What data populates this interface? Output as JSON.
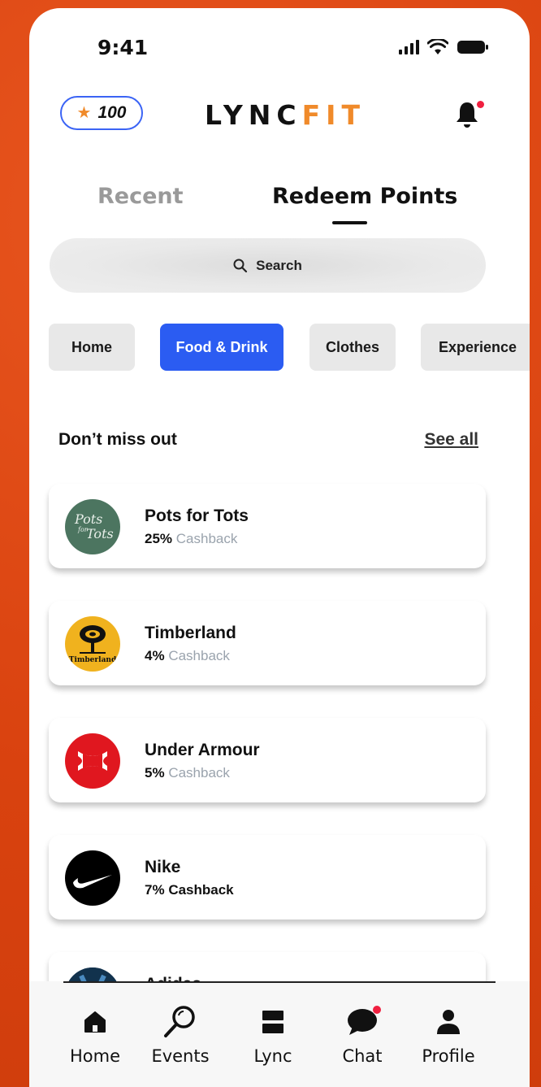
{
  "status": {
    "time": "9:41"
  },
  "header": {
    "points": "100",
    "logo_part1": "LYNC",
    "logo_part2": "FIT",
    "accent": "#f08a2a"
  },
  "tabs": [
    {
      "label": "Recent",
      "active": false
    },
    {
      "label": "Redeem Points",
      "active": true
    }
  ],
  "search": {
    "placeholder": "Search",
    "icon": "search-icon"
  },
  "categories": [
    {
      "label": "Home",
      "active": false
    },
    {
      "label": "Food & Drink",
      "active": true
    },
    {
      "label": "Clothes",
      "active": false
    },
    {
      "label": "Experience",
      "active": false
    }
  ],
  "section": {
    "title": "Don’t miss out",
    "see_all": "See all"
  },
  "offers": [
    {
      "name": "Pots for Tots",
      "percent": "25%",
      "label": "Cashback",
      "logo_text": "Pots for Tots",
      "color": "#4c7560"
    },
    {
      "name": "Timberland",
      "percent": "4%",
      "label": "Cashback",
      "logo_text": "Timberland",
      "color": "#f0b21e"
    },
    {
      "name": "Under Armour",
      "percent": "5%",
      "label": "Cashback",
      "color": "#e0171f"
    },
    {
      "name": "Nike",
      "percent": "7%",
      "label": "Cashback",
      "color": "#000000"
    },
    {
      "name": "Adidas",
      "percent": "",
      "label": "",
      "color": "#1a3a5a"
    }
  ],
  "nav": [
    {
      "label": "Home",
      "icon": "home-icon"
    },
    {
      "label": "Events",
      "icon": "events-search-icon"
    },
    {
      "label": "Lync",
      "icon": "lync-icon"
    },
    {
      "label": "Chat",
      "icon": "chat-icon"
    },
    {
      "label": "Profile",
      "icon": "profile-icon"
    }
  ],
  "colors": {
    "primary_blue": "#2b5cf2",
    "background": "#e0491a",
    "notification": "#f02040"
  }
}
